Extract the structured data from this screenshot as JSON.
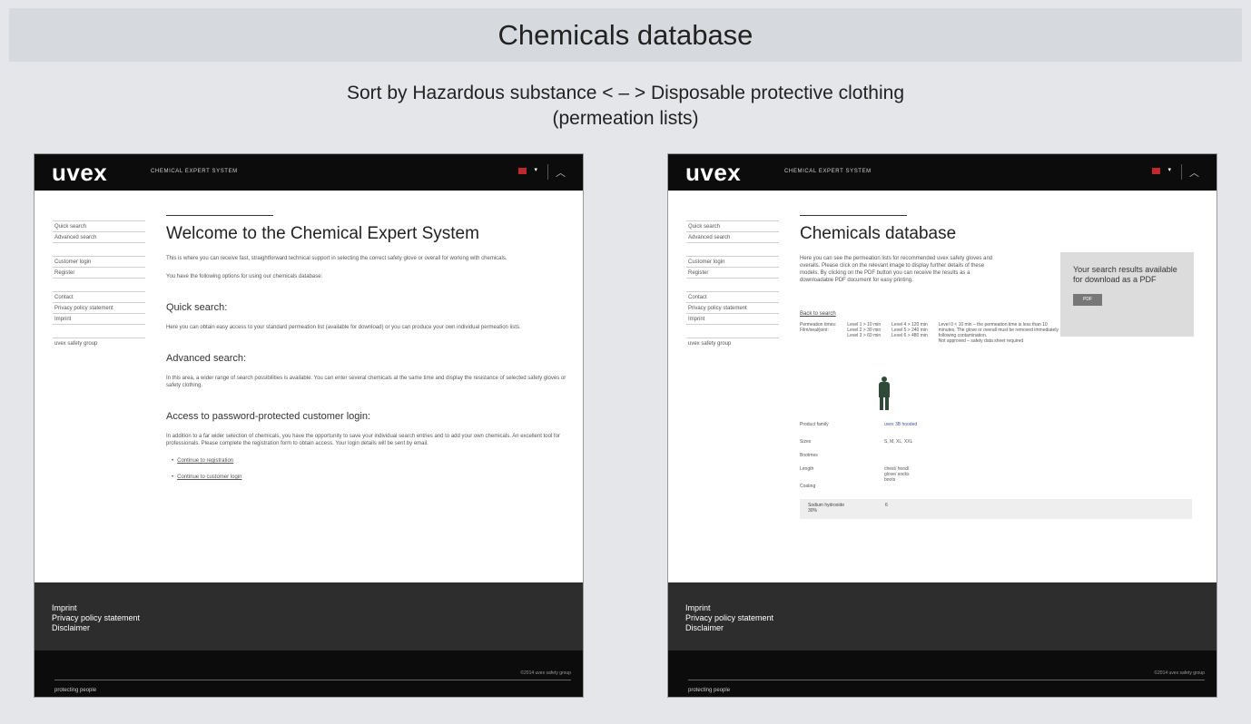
{
  "slide": {
    "title": "Chemicals database",
    "subtitle_line1": "Sort by Hazardous substance < – > Disposable protective clothing",
    "subtitle_line2": "(permeation lists)"
  },
  "site": {
    "logo": "uvex",
    "system_name": "CHEMICAL EXPERT SYSTEM",
    "language_caret": "▾",
    "collapse_chevron": "︿",
    "icons": {
      "flag": "uk-flag-icon",
      "caret": "chevron-down-icon",
      "collapse": "chevron-up-icon"
    },
    "colors": {
      "topbar": "#0c0c0c",
      "footer": "#2d2d2d",
      "flag": "#c0282f"
    }
  },
  "nav": {
    "quick_search": "Quick search",
    "advanced_search": "Advanced search",
    "customer_login": "Customer login",
    "register": "Register",
    "contact": "Contact",
    "privacy": "Privacy policy statement",
    "imprint": "Imprint",
    "safety_group": "uvex safety group"
  },
  "left_page": {
    "title": "Welcome to the Chemical Expert System",
    "intro": "This is where you can receive fast, straightforward technical support in selecting the correct safety glove or overall for working with chemicals.",
    "options": "You have the following options for using our chemicals database:",
    "quick_heading": "Quick search:",
    "quick_text": "Here you can obtain easy access to your standard permeation list (available for download) or you can produce your own individual permeation lists.",
    "advanced_heading": "Advanced search:",
    "advanced_text": "In this area, a wider range of search possibilities is available. You can enter several chemicals at the same time and display the resistance of selected safety gloves or safety clothing.",
    "login_heading": "Access to password-protected customer login:",
    "login_text": "In addition to a far wider selection of chemicals, you have the opportunity to save your individual search entries and to add your own chemicals. An excellent tool for professionals. Please complete the registration form to obtain access. Your login details will be sent by email.",
    "bullet": "•",
    "link_registration": "Continue to registration",
    "link_login": "Continue to customer login"
  },
  "right_page": {
    "title": "Chemicals database",
    "intro": "Here you can see the permeation lists for recommended uvex safety gloves and overalls. Please click on the relevant image to display further details of these models. By clicking on the PDF button you can receive the results as a downloadable PDF document for easy printing.",
    "pdf_text": "Your search results available for download as a PDF",
    "pdf_button": "PDF",
    "back_link": "Back to search",
    "legend_col1": "Permeation times:\nFilm/seal/joint:",
    "legend_col2": "Level 1 > 10 min\nLevel 2 > 30 min\nLevel 3 > 60 min",
    "legend_col3": "Level 4 > 120 min\nLevel 5 > 240 min\nLevel 6 > 480 min",
    "legend_col4": "Level 0 < 10 min – the permeation time is less than 10\nminutes. The glove or overall must be removed immediately\nfollowing contamination.\nNot approved – safety data sheet required",
    "product_family_label": "Product family",
    "product_family_value": "uvex 3B hooded",
    "sizes_label": "Sizes",
    "sizes_value": "S, M, XL, XXL",
    "bootmes_label": "Bootmes",
    "length_label": "Length",
    "length_value": "chest/ hood/\nglove/ socks\nboots",
    "coating_label": "Coating",
    "chemical_name": "Sodium hydroxide\n30%",
    "chemical_value": "6"
  },
  "footer": {
    "imprint": "Imprint",
    "privacy": "Privacy policy statement",
    "disclaimer": "Disclaimer",
    "copyright": "©2014 uvex safety group",
    "tagline": "protecting people"
  }
}
